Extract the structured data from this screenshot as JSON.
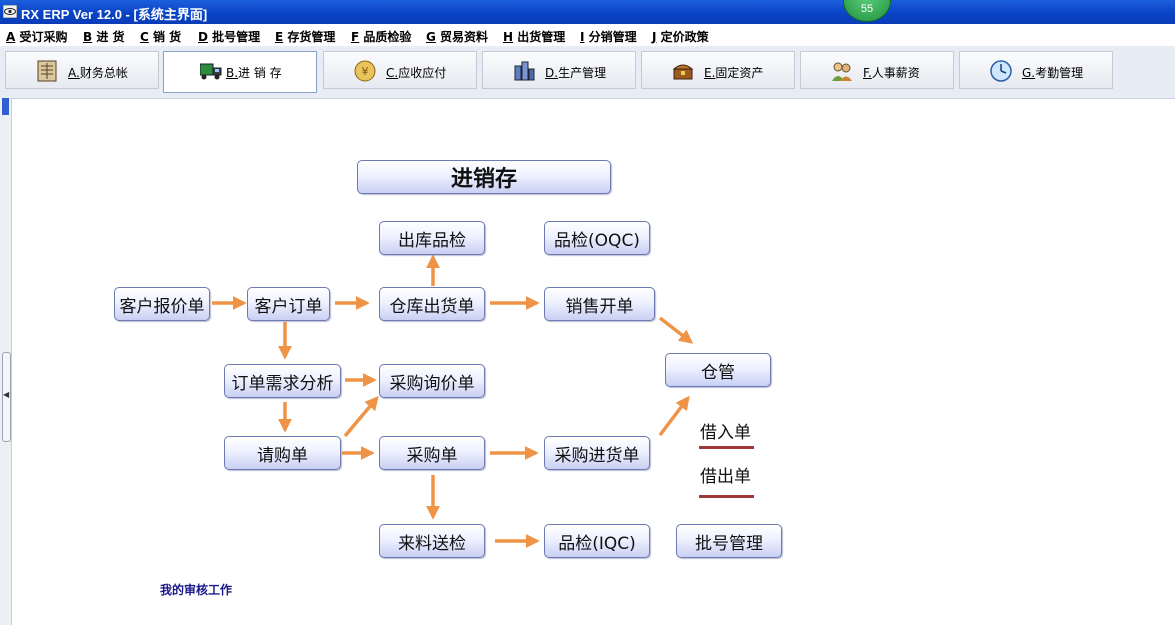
{
  "window": {
    "title": "RX ERP Ver 12.0 - [系统主界面]",
    "notification_count": "55"
  },
  "menu": [
    {
      "key": "A",
      "label": "受订采购"
    },
    {
      "key": "B",
      "label": "进 货"
    },
    {
      "key": "C",
      "label": "销 货"
    },
    {
      "key": "D",
      "label": "批号管理"
    },
    {
      "key": "E",
      "label": "存货管理"
    },
    {
      "key": "F",
      "label": "品质检验"
    },
    {
      "key": "G",
      "label": "贸易资料"
    },
    {
      "key": "H",
      "label": "出货管理"
    },
    {
      "key": "I",
      "label": "分销管理"
    },
    {
      "key": "J",
      "label": "定价政策"
    }
  ],
  "modules": [
    {
      "key": "A.",
      "label": "财务总帐",
      "icon": "ledger-icon"
    },
    {
      "key": "B.",
      "label": "进 销 存",
      "icon": "truck-icon",
      "active": true
    },
    {
      "key": "C.",
      "label": "应收应付",
      "icon": "coin-icon"
    },
    {
      "key": "D.",
      "label": "生产管理",
      "icon": "factory-icon"
    },
    {
      "key": "E.",
      "label": "固定资产",
      "icon": "treasure-icon"
    },
    {
      "key": "F.",
      "label": "人事薪资",
      "icon": "people-icon"
    },
    {
      "key": "G.",
      "label": "考勤管理",
      "icon": "clock-icon"
    }
  ],
  "diagram": {
    "title": "进销存",
    "nodes": {
      "customer_quote": "客户报价单",
      "customer_order": "客户订单",
      "outbound_inspection": "出库品检",
      "oqc": "品检(OQC)",
      "warehouse_shipment": "仓库出货单",
      "sales_invoice": "销售开单",
      "order_demand_analysis": "订单需求分析",
      "purchase_inquiry": "采购询价单",
      "warehouse_keeper": "仓管",
      "purchase_request": "请购单",
      "purchase_order": "采购单",
      "purchase_receipt": "采购进货单",
      "incoming_delivery": "来料送检",
      "iqc": "品检(IQC)",
      "batch_management": "批号管理"
    },
    "links": {
      "borrow_in": "借入单",
      "borrow_out": "借出单"
    },
    "colors": {
      "arrow": "#ef9347",
      "underline": "#a2373a",
      "node_border": "#6d79b0"
    }
  },
  "footer": {
    "my_audit_work": "我的审核工作"
  }
}
